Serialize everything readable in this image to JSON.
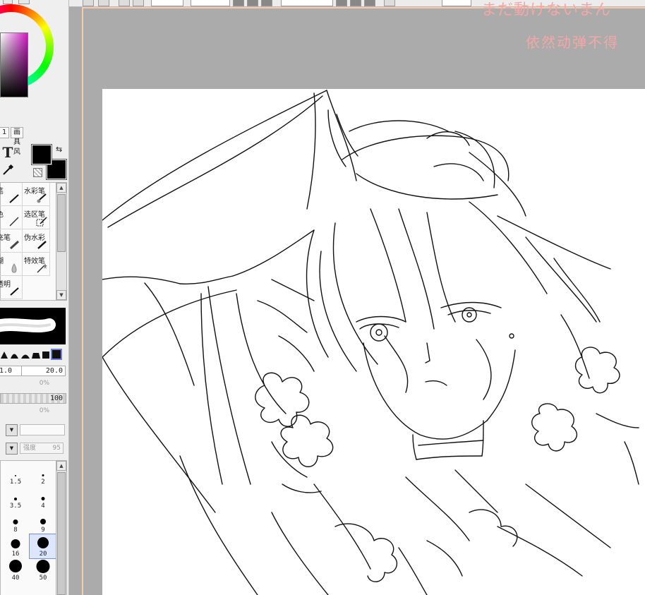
{
  "overlay": {
    "line1": "まだ動けないまん",
    "line2": "依然动弹不得"
  },
  "color_panel": {
    "tab_number": "1",
    "tab_label": "画具风",
    "foreground_color": "#000000",
    "background_color": "#000000"
  },
  "tools": {
    "text_tool_glyph": "T",
    "swap_glyph": "⇆"
  },
  "brush_tools": [
    {
      "label": "笔",
      "icon": "brush-icon"
    },
    {
      "label": "水彩笔",
      "icon": "watercolor-icon"
    },
    {
      "label": "色",
      "icon": "pen-icon"
    },
    {
      "label": "选区笔",
      "icon": "selection-pen-icon"
    },
    {
      "label": "充笔",
      "icon": "marker-icon"
    },
    {
      "label": "伪水彩",
      "icon": "water-brush-icon"
    },
    {
      "label": "糊",
      "icon": "blur-drop-icon"
    },
    {
      "label": "特效笔",
      "icon": "effect-pen-icon"
    },
    {
      "label": "透明",
      "icon": "eraser-icon"
    }
  ],
  "brush_settings": {
    "size_left": "1.0",
    "size_value": "20.0",
    "min_size_pct": "0%",
    "density_value": "100",
    "min_density_pct": "0%",
    "strength_label": "强度",
    "strength_value": "95"
  },
  "size_presets": [
    {
      "label": "1.5",
      "dot": 2
    },
    {
      "label": "2",
      "dot": 3
    },
    {
      "label": "3.5",
      "dot": 4
    },
    {
      "label": "4",
      "dot": 5
    },
    {
      "label": "8",
      "dot": 7
    },
    {
      "label": "9",
      "dot": 8
    },
    {
      "label": "16",
      "dot": 13
    },
    {
      "label": "20",
      "dot": 16,
      "selected": true
    },
    {
      "label": "40",
      "dot": 18
    },
    {
      "label": "50",
      "dot": 19
    }
  ],
  "colors": {
    "canvas_border": "#f7c9a8",
    "overlay_text": "#f3a7a7",
    "workspace": "#ababab"
  }
}
